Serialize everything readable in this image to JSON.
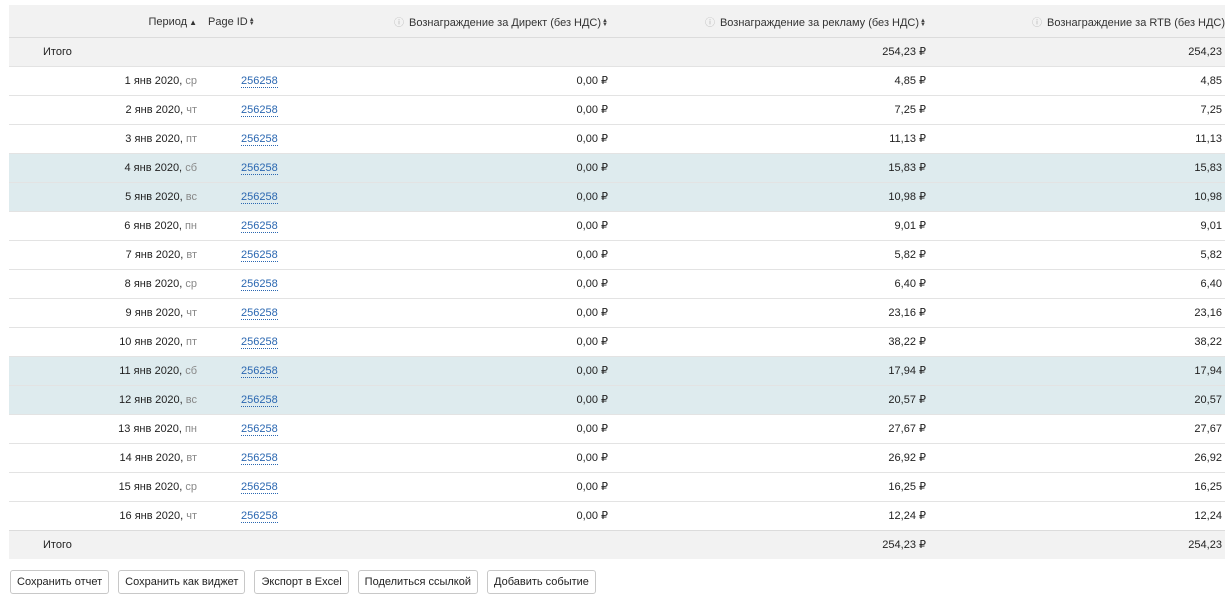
{
  "headers": {
    "period": "Период",
    "page_id": "Page ID",
    "direct": "Вознаграждение за Директ (без НДС)",
    "ads": "Вознаграждение за рекламу (без НДС)",
    "rtb": "Вознаграждение за RTB (без НДС)"
  },
  "sort": {
    "column": "period",
    "direction": "ascending"
  },
  "total": {
    "label": "Итого",
    "direct": "",
    "ads": "254,23 ₽",
    "rtb": "254,23 ₽"
  },
  "rows": [
    {
      "date": "1 янв 2020,",
      "weekday": "ср",
      "page_id": "256258",
      "direct": "0,00 ₽",
      "ads": "4,85 ₽",
      "rtb": "4,85 ₽",
      "weekend": false
    },
    {
      "date": "2 янв 2020,",
      "weekday": "чт",
      "page_id": "256258",
      "direct": "0,00 ₽",
      "ads": "7,25 ₽",
      "rtb": "7,25 ₽",
      "weekend": false
    },
    {
      "date": "3 янв 2020,",
      "weekday": "пт",
      "page_id": "256258",
      "direct": "0,00 ₽",
      "ads": "11,13 ₽",
      "rtb": "11,13 ₽",
      "weekend": false
    },
    {
      "date": "4 янв 2020,",
      "weekday": "сб",
      "page_id": "256258",
      "direct": "0,00 ₽",
      "ads": "15,83 ₽",
      "rtb": "15,83 ₽",
      "weekend": true
    },
    {
      "date": "5 янв 2020,",
      "weekday": "вс",
      "page_id": "256258",
      "direct": "0,00 ₽",
      "ads": "10,98 ₽",
      "rtb": "10,98 ₽",
      "weekend": true
    },
    {
      "date": "6 янв 2020,",
      "weekday": "пн",
      "page_id": "256258",
      "direct": "0,00 ₽",
      "ads": "9,01 ₽",
      "rtb": "9,01 ₽",
      "weekend": false
    },
    {
      "date": "7 янв 2020,",
      "weekday": "вт",
      "page_id": "256258",
      "direct": "0,00 ₽",
      "ads": "5,82 ₽",
      "rtb": "5,82 ₽",
      "weekend": false
    },
    {
      "date": "8 янв 2020,",
      "weekday": "ср",
      "page_id": "256258",
      "direct": "0,00 ₽",
      "ads": "6,40 ₽",
      "rtb": "6,40 ₽",
      "weekend": false
    },
    {
      "date": "9 янв 2020,",
      "weekday": "чт",
      "page_id": "256258",
      "direct": "0,00 ₽",
      "ads": "23,16 ₽",
      "rtb": "23,16 ₽",
      "weekend": false
    },
    {
      "date": "10 янв 2020,",
      "weekday": "пт",
      "page_id": "256258",
      "direct": "0,00 ₽",
      "ads": "38,22 ₽",
      "rtb": "38,22 ₽",
      "weekend": false
    },
    {
      "date": "11 янв 2020,",
      "weekday": "сб",
      "page_id": "256258",
      "direct": "0,00 ₽",
      "ads": "17,94 ₽",
      "rtb": "17,94 ₽",
      "weekend": true
    },
    {
      "date": "12 янв 2020,",
      "weekday": "вс",
      "page_id": "256258",
      "direct": "0,00 ₽",
      "ads": "20,57 ₽",
      "rtb": "20,57 ₽",
      "weekend": true
    },
    {
      "date": "13 янв 2020,",
      "weekday": "пн",
      "page_id": "256258",
      "direct": "0,00 ₽",
      "ads": "27,67 ₽",
      "rtb": "27,67 ₽",
      "weekend": false
    },
    {
      "date": "14 янв 2020,",
      "weekday": "вт",
      "page_id": "256258",
      "direct": "0,00 ₽",
      "ads": "26,92 ₽",
      "rtb": "26,92 ₽",
      "weekend": false
    },
    {
      "date": "15 янв 2020,",
      "weekday": "ср",
      "page_id": "256258",
      "direct": "0,00 ₽",
      "ads": "16,25 ₽",
      "rtb": "16,25 ₽",
      "weekend": false
    },
    {
      "date": "16 янв 2020,",
      "weekday": "чт",
      "page_id": "256258",
      "direct": "0,00 ₽",
      "ads": "12,24 ₽",
      "rtb": "12,24 ₽",
      "weekend": false
    }
  ],
  "buttons": {
    "save_report": "Сохранить отчет",
    "save_widget": "Сохранить как виджет",
    "export_excel": "Экспорт в Excel",
    "share_link": "Поделиться ссылкой",
    "add_event": "Добавить событие"
  },
  "icons": {
    "help": "help-circle-icon",
    "sort_asc": "sort-ascending-icon",
    "sort_both": "sort-both-icon"
  },
  "colors": {
    "link": "#2a67b1",
    "weekend_row": "#deebee",
    "header_bg": "#f2f2f2"
  }
}
